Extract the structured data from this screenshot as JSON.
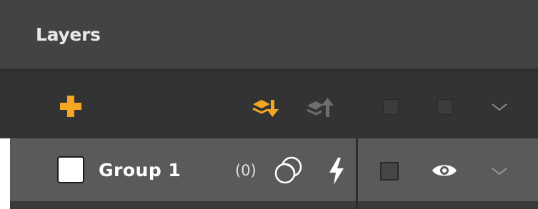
{
  "panel": {
    "title": "Layers"
  },
  "toolbar": {
    "add_icon": "plus-icon",
    "send_down_icon": "layers-arrow-down-icon",
    "bring_up_icon": "layers-arrow-up-icon",
    "visibility_toggle_icon": "square-icon",
    "lock_toggle_icon": "square-icon",
    "expand_icon": "chevron-down-icon"
  },
  "layers": [
    {
      "name": "Group 1",
      "count": "(0)",
      "selected": false,
      "blend_icon": "blend-circles-icon",
      "effects_icon": "lightning-icon",
      "visible_icon": "eye-icon",
      "expand_icon": "chevron-down-icon"
    }
  ],
  "colors": {
    "accent": "#f5a623",
    "accent_disabled": "#6e6e6e"
  }
}
